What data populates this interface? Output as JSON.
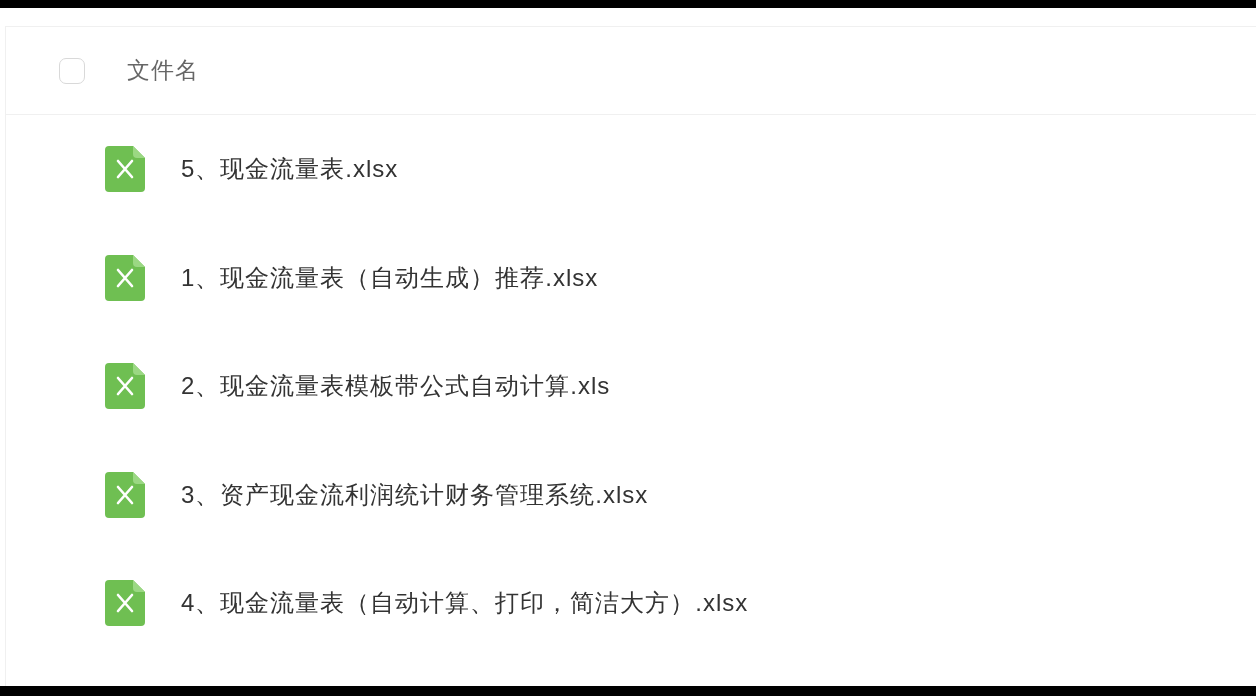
{
  "table": {
    "header": {
      "select_all": {
        "checked": false
      },
      "column": "文件名"
    },
    "files": [
      {
        "name": "5、现金流量表.xlsx"
      },
      {
        "name": "1、现金流量表（自动生成）推荐.xlsx"
      },
      {
        "name": "2、现金流量表模板带公式自动计算.xls"
      },
      {
        "name": "3、资产现金流利润统计财务管理系统.xlsx"
      },
      {
        "name": "4、现金流量表（自动计算、打印，简洁大方）.xlsx"
      }
    ]
  }
}
